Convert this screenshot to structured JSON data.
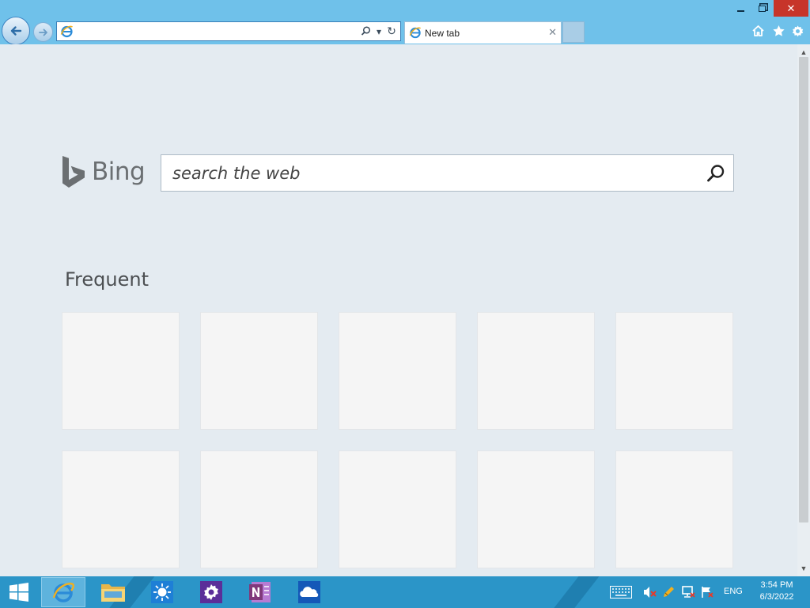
{
  "window": {
    "minimize_icon": "minimize-icon",
    "restore_icon": "restore-icon",
    "close_icon": "close-icon",
    "close_glyph": "✕",
    "close_color": "#c7352a"
  },
  "nav": {
    "back_icon": "back-arrow-icon",
    "forward_icon": "forward-arrow-icon",
    "address_value": "",
    "address_placeholder": "",
    "search_icon": "search-icon",
    "dropdown_glyph": "▾",
    "refresh_glyph": "↻"
  },
  "tabs": [
    {
      "label": "New tab",
      "close_glyph": "✕",
      "active": true
    }
  ],
  "toolbar": {
    "home_icon": "home-icon",
    "favorites_icon": "star-icon",
    "settings_icon": "gear-icon"
  },
  "content": {
    "brand": "Bing",
    "search_placeholder": "search the web",
    "search_value": "",
    "frequent_title": "Frequent",
    "tiles": [
      "",
      "",
      "",
      "",
      "",
      "",
      "",
      "",
      "",
      ""
    ]
  },
  "taskbar": {
    "apps": [
      {
        "name": "internet-explorer",
        "active": true
      },
      {
        "name": "file-explorer",
        "active": false
      },
      {
        "name": "weather",
        "active": false
      },
      {
        "name": "settings",
        "active": false
      },
      {
        "name": "onenote",
        "active": false
      },
      {
        "name": "onedrive",
        "active": false
      }
    ],
    "tray": {
      "keyboard_icon": "touch-keyboard-icon",
      "volume_icon": "volume-muted-icon",
      "pen_icon": "pen-icon",
      "network_icon": "network-icon",
      "flag_icon": "action-center-icon",
      "language": "ENG"
    },
    "clock": {
      "time": "3:54 PM",
      "date": "6/3/2022"
    }
  },
  "colors": {
    "chrome": "#6fc1ea",
    "taskbar": "#2b95c8",
    "page_bg": "#e4ebf1",
    "tile": "#f5f5f5"
  }
}
